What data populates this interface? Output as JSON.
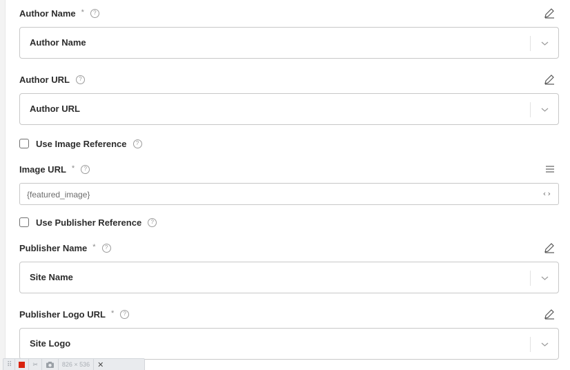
{
  "fields": {
    "author_name": {
      "label": "Author Name",
      "required_mark": "*",
      "help": "?",
      "value": "Author Name"
    },
    "author_url": {
      "label": "Author URL",
      "help": "?",
      "value": "Author URL"
    },
    "use_image_reference": {
      "label": "Use Image Reference",
      "help": "?",
      "checked": false
    },
    "image_url": {
      "label": "Image URL",
      "required_mark": "*",
      "help": "?",
      "value": "{featured_image}",
      "code_toggle": "‹›"
    },
    "use_publisher_reference": {
      "label": "Use Publisher Reference",
      "help": "?",
      "checked": false
    },
    "publisher_name": {
      "label": "Publisher Name",
      "required_mark": "*",
      "help": "?",
      "value": "Site Name"
    },
    "publisher_logo_url": {
      "label": "Publisher Logo URL",
      "required_mark": "*",
      "help": "?",
      "value": "Site Logo"
    }
  },
  "toolbar": {
    "grip": "⠿",
    "crop": "✂",
    "dimensions": "826 × 536",
    "close": "✕"
  },
  "icons": {
    "edit": "pencil-icon",
    "dropdown": "chevron-down-icon",
    "list": "list-icon",
    "help": "question-circle-icon",
    "code": "code-icon",
    "camera": "camera-icon",
    "record": "record-icon"
  },
  "colors": {
    "border": "#c7c7c7",
    "record": "#d9230f"
  }
}
